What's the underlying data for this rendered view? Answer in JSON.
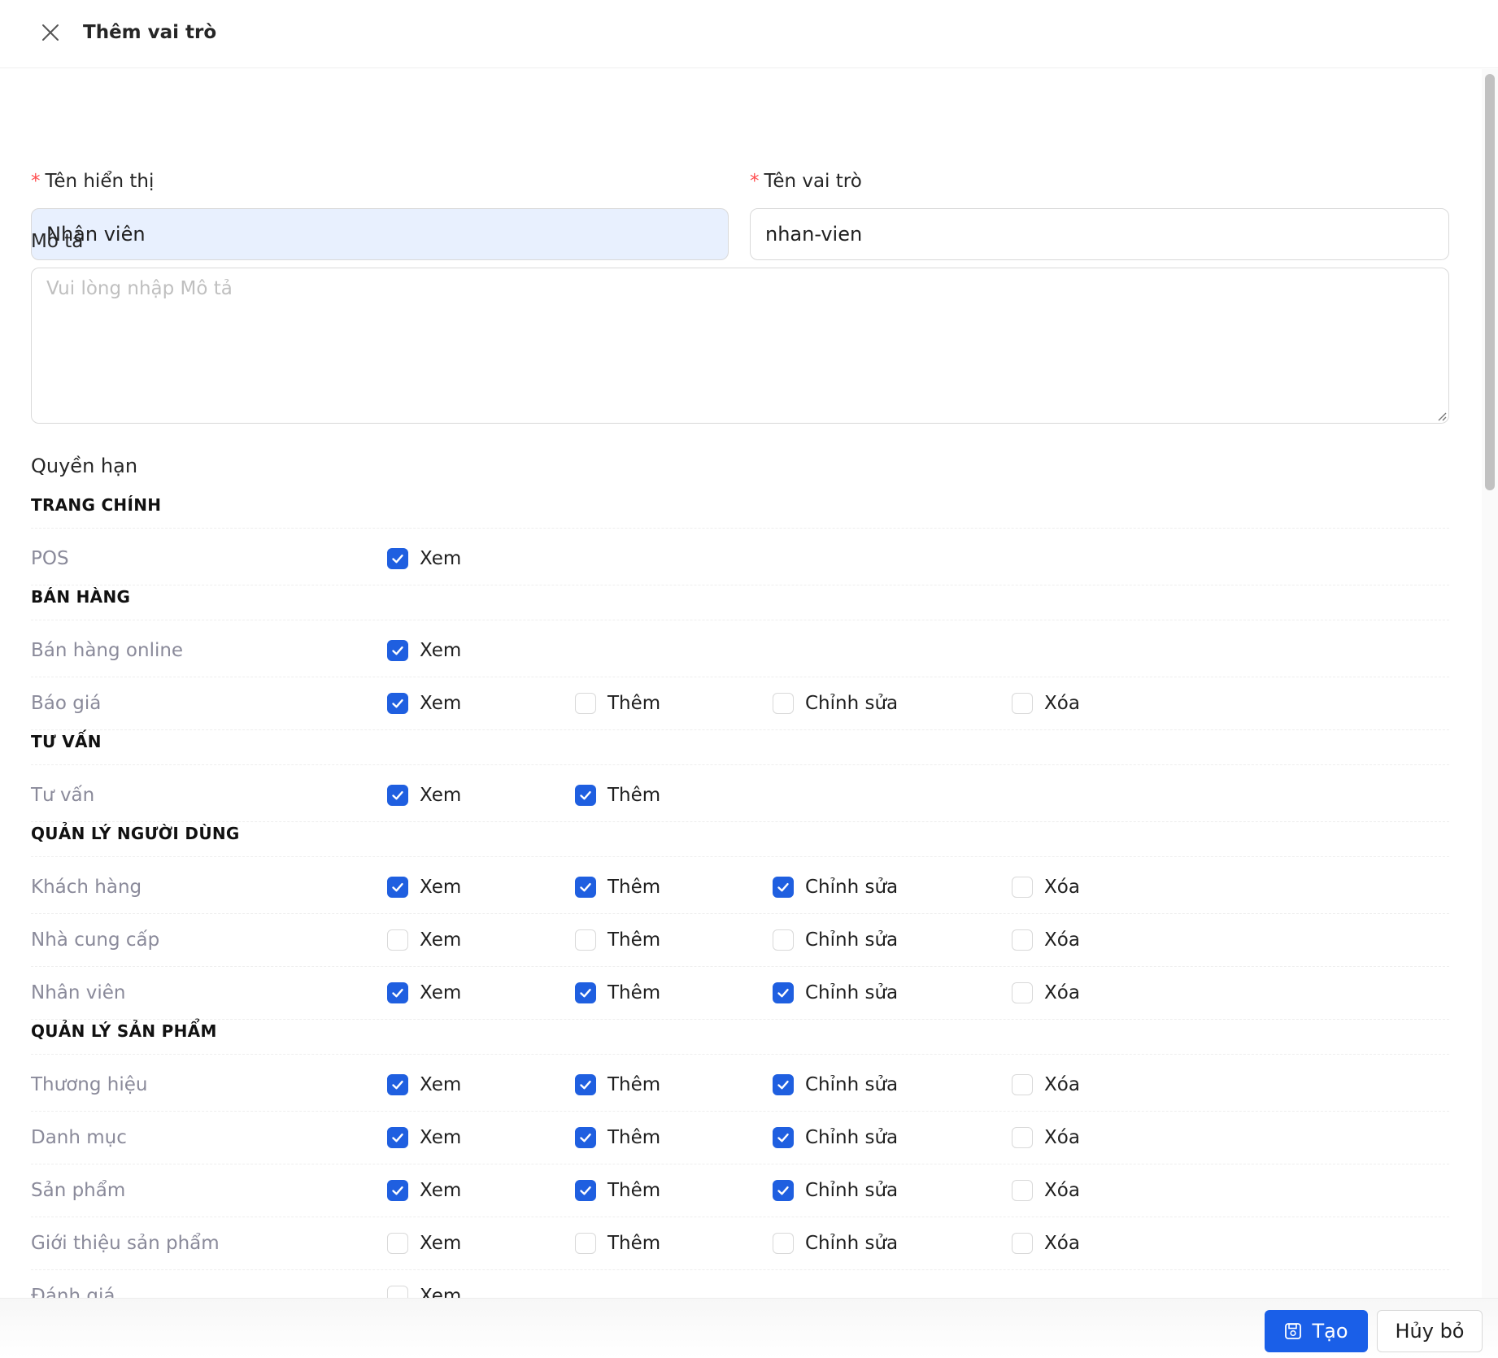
{
  "dialog": {
    "title": "Thêm vai trò"
  },
  "form": {
    "display_name": {
      "label": "Tên hiển thị",
      "required_mark": "*",
      "value": "Nhân viên"
    },
    "role_name": {
      "label": "Tên vai trò",
      "required_mark": "*",
      "value": "nhan-vien"
    },
    "description": {
      "label": "Mô tả",
      "value": "",
      "placeholder": "Vui lòng nhập Mô tả"
    }
  },
  "permissions": {
    "title": "Quyền hạn",
    "action_labels": {
      "view": "Xem",
      "add": "Thêm",
      "edit": "Chỉnh sửa",
      "delete": "Xóa"
    },
    "sections": [
      {
        "title": "TRANG CHÍNH",
        "rows": [
          {
            "label": "POS",
            "view": true
          }
        ]
      },
      {
        "title": "BÁN HÀNG",
        "rows": [
          {
            "label": "Bán hàng online",
            "view": true
          },
          {
            "label": "Báo giá",
            "view": true,
            "add": false,
            "edit": false,
            "delete": false
          }
        ]
      },
      {
        "title": "TƯ VẤN",
        "rows": [
          {
            "label": "Tư vấn",
            "view": true,
            "add": true
          }
        ]
      },
      {
        "title": "QUẢN LÝ NGƯỜI DÙNG",
        "rows": [
          {
            "label": "Khách hàng",
            "view": true,
            "add": true,
            "edit": true,
            "delete": false
          },
          {
            "label": "Nhà cung cấp",
            "view": false,
            "add": false,
            "edit": false,
            "delete": false
          },
          {
            "label": "Nhân viên",
            "view": true,
            "add": true,
            "edit": true,
            "delete": false
          }
        ]
      },
      {
        "title": "QUẢN LÝ SẢN PHẨM",
        "rows": [
          {
            "label": "Thương hiệu",
            "view": true,
            "add": true,
            "edit": true,
            "delete": false
          },
          {
            "label": "Danh mục",
            "view": true,
            "add": true,
            "edit": true,
            "delete": false
          },
          {
            "label": "Sản phẩm",
            "view": true,
            "add": true,
            "edit": true,
            "delete": false
          },
          {
            "label": "Giới thiệu sản phẩm",
            "view": false,
            "add": false,
            "edit": false,
            "delete": false
          },
          {
            "label": "Đánh giá",
            "view": false
          }
        ]
      }
    ]
  },
  "footer": {
    "create_label": "Tạo",
    "cancel_label": "Hủy bỏ"
  },
  "icons": {
    "close": "close-icon",
    "save": "save-icon",
    "check": "check-icon"
  },
  "colors": {
    "primary": "#1a5fe8",
    "required": "#ff4d4f",
    "muted_label": "#8a8a9a",
    "filled_input": "#e8f0fe"
  }
}
